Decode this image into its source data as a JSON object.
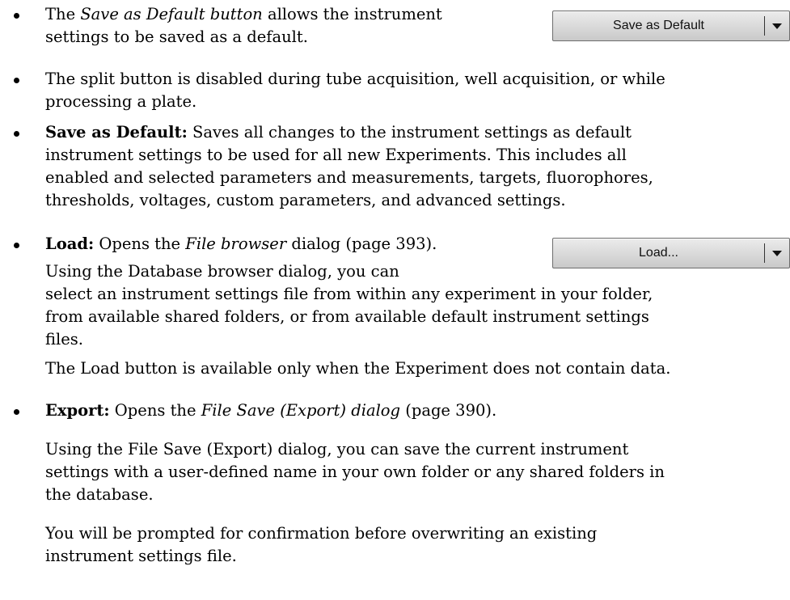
{
  "items": {
    "save_button_desc": {
      "prefix": "The ",
      "link": "Save as Default button",
      "rest_line1": " allows the instrument",
      "line2": "settings to be saved as a default."
    },
    "split_disabled": {
      "line1": "The split button is disabled during tube acquisition, well acquisition, or while",
      "line2": "processing a plate."
    },
    "save_as_default": {
      "term": "Save as Default:",
      "line1": " Saves all changes to the instrument settings as default",
      "line2": "instrument settings to be used for all new Experiments. This includes all",
      "line3": "enabled and selected parameters and measurements, targets, fluorophores,",
      "line4": "thresholds, voltages, custom parameters, and advanced settings."
    },
    "load": {
      "term": "Load:",
      "text": " Opens the ",
      "link": "File browser",
      "rest": " dialog (page 393).",
      "p1_line1": "Using the Database browser dialog, you can",
      "p1_line2": "select an instrument settings file from within any experiment in your folder,",
      "p1_line3": "from available shared folders, or from available default instrument settings",
      "p1_line4": "files.",
      "p2": "The Load button is available only when the Experiment does not contain data."
    },
    "export": {
      "term": "Export:",
      "text": " Opens the ",
      "link": "File Save (Export) dialog",
      "rest": " (page 390).",
      "p1_line1": "Using the File Save (Export) dialog, you can save the current instrument",
      "p1_line2": "settings with a user-defined name in your own folder or any shared folders in",
      "p1_line3": "the database.",
      "p2_line1": "You will be prompted for confirmation before overwriting an existing",
      "p2_line2": "instrument settings file."
    }
  },
  "buttons": {
    "save_default": "Save as Default",
    "load": "Load..."
  }
}
